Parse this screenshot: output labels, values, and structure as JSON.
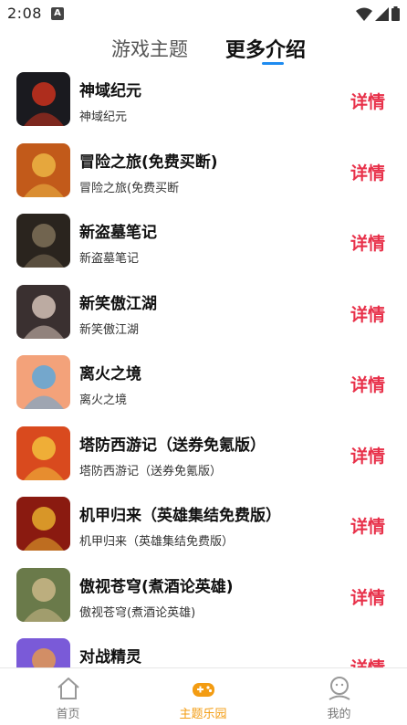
{
  "status_bar": {
    "time": "2:08",
    "notification_letter": "A"
  },
  "tabs": [
    {
      "label": "游戏主题",
      "active": false
    },
    {
      "label": "更多介绍",
      "active": true
    }
  ],
  "games": [
    {
      "title": "神域纪元",
      "desc": "神域纪元",
      "detail": "详情",
      "icon_bg": "#1a1a1f",
      "icon_accent": "#e0341e"
    },
    {
      "title": "冒险之旅(免费买断)",
      "desc": "冒险之旅(免费买断",
      "detail": "详情",
      "icon_bg": "#c25a1a",
      "icon_accent": "#f2c24a"
    },
    {
      "title": "新盗墓笔记",
      "desc": "新盗墓笔记",
      "detail": "详情",
      "icon_bg": "#2a241e",
      "icon_accent": "#8a7a60"
    },
    {
      "title": "新笑傲江湖",
      "desc": "新笑傲江湖",
      "detail": "详情",
      "icon_bg": "#3a3030",
      "icon_accent": "#e8d4c8"
    },
    {
      "title": "离火之境",
      "desc": "离火之境",
      "detail": "详情",
      "icon_bg": "#f3a27a",
      "icon_accent": "#4aa8e8"
    },
    {
      "title": "塔防西游记（送券免氪版）",
      "desc": "塔防西游记（送券免氪版）",
      "detail": "详情",
      "icon_bg": "#d94a1e",
      "icon_accent": "#f5d040"
    },
    {
      "title": "机甲归来（英雄集结免费版）",
      "desc": "机甲归来（英雄集结免费版）",
      "detail": "详情",
      "icon_bg": "#8a1a10",
      "icon_accent": "#f2c030"
    },
    {
      "title": "傲视苍穹(煮酒论英雄)",
      "desc": "傲视苍穹(煮酒论英雄)",
      "detail": "详情",
      "icon_bg": "#6a7a4a",
      "icon_accent": "#d8c090"
    },
    {
      "title": "对战精灵",
      "desc": "",
      "detail": "详情",
      "icon_bg": "#7a5ad8",
      "icon_accent": "#f0a040"
    }
  ],
  "bottom_nav": [
    {
      "label": "首页",
      "icon": "home-icon",
      "active": false
    },
    {
      "label": "主题乐园",
      "icon": "gamepad-icon",
      "active": true
    },
    {
      "label": "我的",
      "icon": "user-icon",
      "active": false
    }
  ],
  "colors": {
    "accent_tab": "#1e8bf0",
    "detail_red": "#e8314a",
    "nav_active": "#f39c12"
  }
}
